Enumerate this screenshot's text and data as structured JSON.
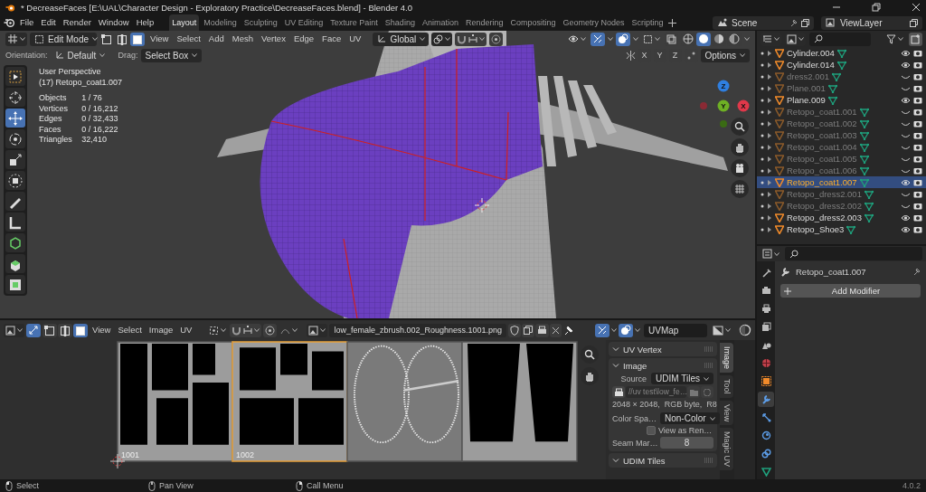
{
  "window": {
    "title": "* DecreaseFaces [E:\\UAL\\Character Design - Exploratory Practice\\DecreaseFaces.blend] - Blender 4.0"
  },
  "menu_bar": {
    "menus": [
      "File",
      "Edit",
      "Render",
      "Window",
      "Help"
    ],
    "workspaces": [
      {
        "label": "Layout",
        "selected": true
      },
      {
        "label": "Modeling",
        "selected": false
      },
      {
        "label": "Sculpting",
        "selected": false
      },
      {
        "label": "UV Editing",
        "selected": false
      },
      {
        "label": "Texture Paint",
        "selected": false
      },
      {
        "label": "Shading",
        "selected": false
      },
      {
        "label": "Animation",
        "selected": false
      },
      {
        "label": "Rendering",
        "selected": false
      },
      {
        "label": "Compositing",
        "selected": false
      },
      {
        "label": "Geometry Nodes",
        "selected": false
      },
      {
        "label": "Scripting",
        "selected": false
      }
    ],
    "scene": "Scene",
    "view_layer": "ViewLayer"
  },
  "viewport": {
    "mode": "Edit Mode",
    "select_modes": [
      {
        "kind": "vertex",
        "selected": false
      },
      {
        "kind": "edge",
        "selected": false
      },
      {
        "kind": "face",
        "selected": true
      }
    ],
    "menus": [
      "View",
      "Select",
      "Add",
      "Mesh",
      "Vertex",
      "Edge",
      "Face",
      "UV"
    ],
    "transform_orientation": "Global",
    "orientation_label": "Orientation:",
    "orientation": "Default",
    "drag_label": "Drag:",
    "drag": "Select Box",
    "axes": [
      "X",
      "Y",
      "Z"
    ],
    "options": "Options",
    "tools": [
      {
        "kind": "select",
        "selected": false
      },
      {
        "kind": "cursor",
        "selected": false
      },
      {
        "kind": "move",
        "selected": true
      },
      {
        "kind": "rotate",
        "selected": false
      },
      {
        "kind": "scale",
        "selected": false
      },
      {
        "kind": "transform",
        "selected": false
      },
      {
        "kind": "annotate",
        "selected": false
      },
      {
        "kind": "measure",
        "selected": false
      },
      {
        "kind": "add_cube",
        "selected": false
      },
      {
        "kind": "extrude",
        "selected": false
      },
      {
        "kind": "inset",
        "selected": false
      }
    ],
    "info": {
      "view": "User Perspective",
      "object": "(17) Retopo_coat1.007",
      "stats": [
        {
          "label": "Objects",
          "value": "1 / 76"
        },
        {
          "label": "Vertices",
          "value": "0 / 16,212"
        },
        {
          "label": "Edges",
          "value": "0 / 32,433"
        },
        {
          "label": "Faces",
          "value": "0 / 16,222"
        },
        {
          "label": "Triangles",
          "value": "32,410"
        }
      ]
    },
    "gizmo": [
      {
        "label": "Z",
        "color": "#2f7fe0"
      },
      {
        "label": "Y",
        "color": "#6eb024"
      },
      {
        "label": "X",
        "color": "#e0384a"
      }
    ]
  },
  "uv_editor": {
    "select_modes": [
      {
        "kind": "vertex",
        "selected": false
      },
      {
        "kind": "edge",
        "selected": false
      },
      {
        "kind": "face",
        "selected": true
      }
    ],
    "menus": [
      "View",
      "Select",
      "Image",
      "UV"
    ],
    "image": "low_female_zbrush.002_Roughness.1001.png",
    "uv_map": "UVMap",
    "tiles": [
      {
        "label": "1001",
        "selected": false
      },
      {
        "label": "1002",
        "selected": true
      },
      {
        "selected": false
      },
      {
        "selected": false
      }
    ],
    "panels": [
      {
        "title": "UV Vertex",
        "expanded": true
      },
      {
        "title": "Image",
        "expanded": true
      },
      {
        "title": "UDIM Tiles",
        "expanded": true
      }
    ],
    "source_label": "Source",
    "source": "UDIM Tiles",
    "path": "//uv test\\low_fe…",
    "info": "2048 × 2048,  RGB byte,  R8",
    "color_space_label": "Color Spa…",
    "color_space": "Non-Color",
    "view_as_render": {
      "label": "View as Ren…",
      "checked": false
    },
    "seam_label": "Seam Mar…",
    "seam_value": "8",
    "tabs": [
      {
        "label": "Image",
        "selected": true
      },
      {
        "label": "Tool",
        "selected": false
      },
      {
        "label": "View",
        "selected": false
      },
      {
        "label": "Magic UV",
        "selected": false
      }
    ]
  },
  "outliner": {
    "rows": [
      {
        "name": "Cylinder.004",
        "visible": true,
        "selected": false
      },
      {
        "name": "Cylinder.014",
        "visible": true,
        "selected": false
      },
      {
        "name": "dress2.001",
        "visible": false,
        "selected": false
      },
      {
        "name": "Plane.001",
        "visible": false,
        "selected": false
      },
      {
        "name": "Plane.009",
        "visible": true,
        "selected": false
      },
      {
        "name": "Retopo_coat1.001",
        "visible": false,
        "selected": false
      },
      {
        "name": "Retopo_coat1.002",
        "visible": false,
        "selected": false
      },
      {
        "name": "Retopo_coat1.003",
        "visible": false,
        "selected": false
      },
      {
        "name": "Retopo_coat1.004",
        "visible": false,
        "selected": false
      },
      {
        "name": "Retopo_coat1.005",
        "visible": false,
        "selected": false
      },
      {
        "name": "Retopo_coat1.006",
        "visible": false,
        "selected": false
      },
      {
        "name": "Retopo_coat1.007",
        "visible": true,
        "selected": true
      },
      {
        "name": "Retopo_dress2.001",
        "visible": false,
        "selected": false
      },
      {
        "name": "Retopo_dress2.002",
        "visible": false,
        "selected": false
      },
      {
        "name": "Retopo_dress2.003",
        "visible": true,
        "selected": false
      },
      {
        "name": "Retopo_Shoe3",
        "visible": true,
        "selected": false
      }
    ]
  },
  "properties": {
    "tabs": [
      {
        "kind": "tool",
        "selected": false
      },
      {
        "kind": "render",
        "selected": false
      },
      {
        "kind": "output",
        "selected": false
      },
      {
        "kind": "view_layer",
        "selected": false
      },
      {
        "kind": "scene",
        "selected": false
      },
      {
        "kind": "world",
        "selected": false
      },
      {
        "kind": "object",
        "selected": false
      },
      {
        "kind": "modifier",
        "selected": true
      },
      {
        "kind": "particles",
        "selected": false
      },
      {
        "kind": "physics",
        "selected": false
      },
      {
        "kind": "constraints",
        "selected": false
      },
      {
        "kind": "data",
        "selected": false
      }
    ],
    "object_name": "Retopo_coat1.007",
    "add_button": "Add Modifier"
  },
  "status_bar": {
    "hints": [
      {
        "kind": "left_mouse",
        "label": "Select"
      },
      {
        "kind": "middle_mouse",
        "label": "Pan View"
      },
      {
        "kind": "right_mouse",
        "label": "Call Menu"
      }
    ],
    "version": "4.0.2"
  }
}
